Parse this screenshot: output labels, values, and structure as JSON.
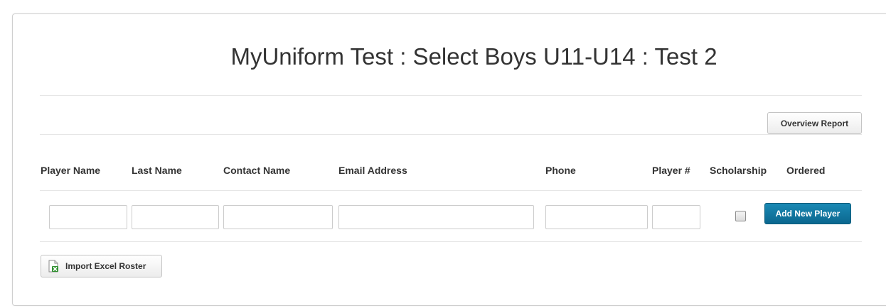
{
  "header": {
    "title": "MyUniform Test : Select Boys U11-U14 : Test 2"
  },
  "toolbar": {
    "overview_report_label": "Overview Report"
  },
  "roster_table": {
    "columns": [
      "Player Name",
      "Last Name",
      "Contact Name",
      "Email Address",
      "Phone",
      "Player #",
      "Scholarship",
      "Ordered"
    ],
    "new_row": {
      "player_name": "",
      "last_name": "",
      "contact_name": "",
      "email_address": "",
      "phone": "",
      "player_number": "",
      "scholarship_checked": false
    },
    "add_button_label": "Add New Player"
  },
  "footer": {
    "import_label": "Import Excel Roster",
    "import_icon": "excel-file-icon"
  },
  "colors": {
    "primary_button": "#0b678f",
    "text": "#333333",
    "border": "#cccccc"
  }
}
